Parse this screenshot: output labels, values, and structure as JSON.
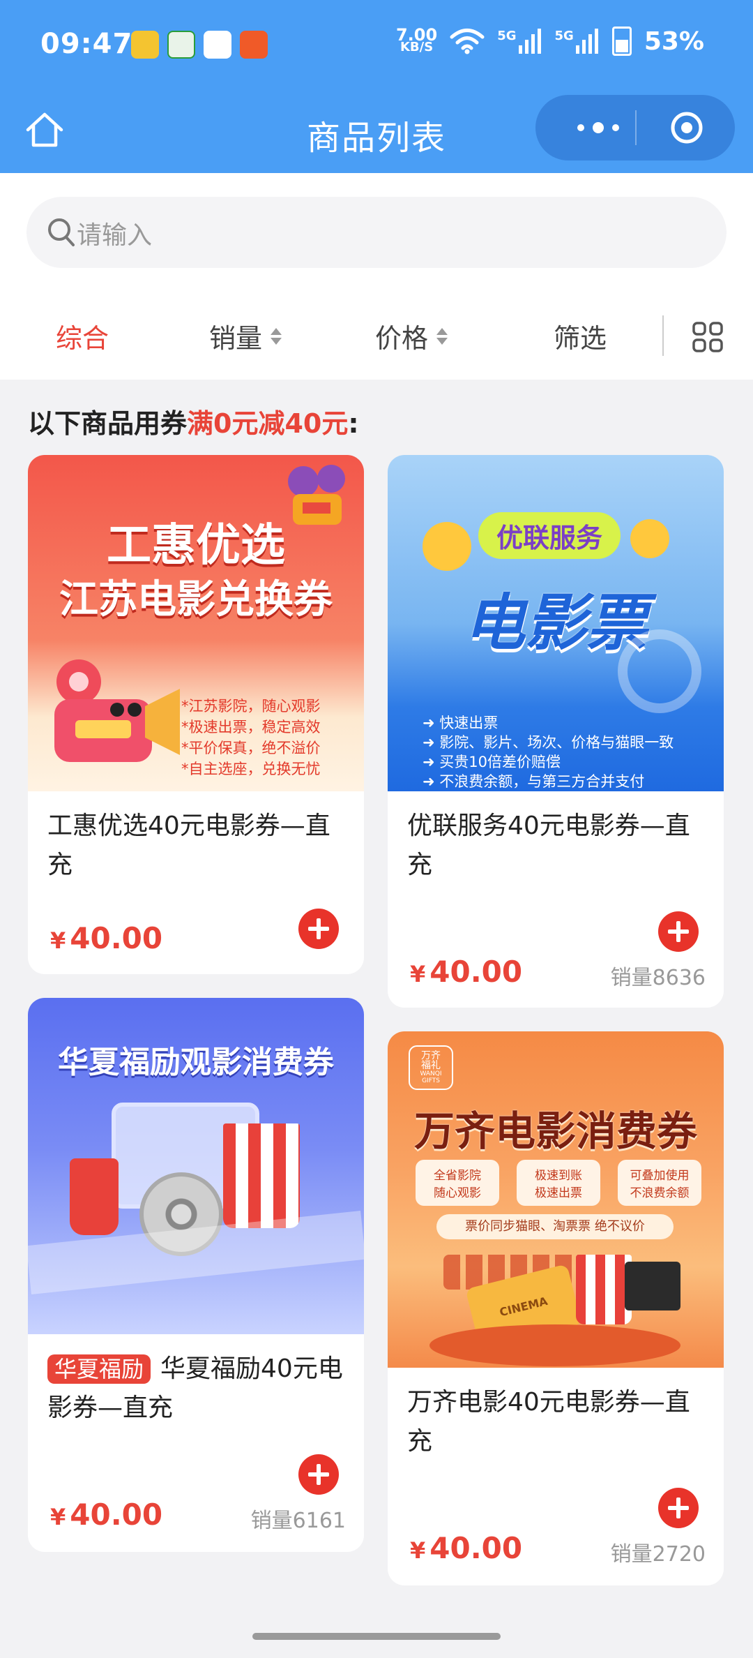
{
  "status_bar": {
    "time": "09:47",
    "net_speed_value": "7.00",
    "net_speed_unit": "KB/S",
    "signal_1": "5G",
    "signal_2": "5G",
    "battery": "53%"
  },
  "nav": {
    "title": "商品列表"
  },
  "search": {
    "placeholder": "请输入"
  },
  "tabs": [
    {
      "label": "综合",
      "active": true
    },
    {
      "label": "销量"
    },
    {
      "label": "价格"
    },
    {
      "label": "筛选"
    }
  ],
  "coupon_notice": {
    "prefix": "以下商品用券",
    "highlight": "满0元减40元",
    "suffix": ":"
  },
  "products": [
    {
      "title": "工惠优选40元电影券—直充",
      "currency": "¥",
      "price": "40.00",
      "sales": "",
      "image_text": {
        "line1": "工惠优选",
        "line2": "江苏电影兑换券",
        "bullets": [
          "*江苏影院，随心观影",
          "*极速出票，稳定高效",
          "*平价保真，绝不溢价",
          "*自主选座，兑换无忧"
        ]
      }
    },
    {
      "title": "优联服务40元电影券—直充",
      "currency": "¥",
      "price": "40.00",
      "sales": "销量8636",
      "image_text": {
        "badge": "优联服务",
        "headline": "电影票",
        "bullets": [
          "快速出票",
          "影院、影片、场次、价格与猫眼一致",
          "买贵10倍差价赔偿",
          "不浪费余额，与第三方合并支付"
        ]
      }
    },
    {
      "tag": "华夏福励",
      "title": "华夏福励40元电影券—直充",
      "currency": "¥",
      "price": "40.00",
      "sales": "销量6161",
      "image_text": {
        "headline": "华夏福励观影消费券"
      }
    },
    {
      "title": "万齐电影40元电影券—直充",
      "currency": "¥",
      "price": "40.00",
      "sales": "销量2720",
      "image_text": {
        "logo_line1": "万齐",
        "logo_line2": "福礼",
        "logo_en_1": "WANQI",
        "logo_en_2": "GIFTS",
        "headline": "万齐电影消费券",
        "features": [
          "全省影院",
          "随心观影",
          "极速到账",
          "极速出票",
          "可叠加使用",
          "不浪费余额"
        ],
        "note": "票价同步猫眼、淘票票 绝不议价",
        "ticket_label": "CINEMA"
      }
    }
  ]
}
